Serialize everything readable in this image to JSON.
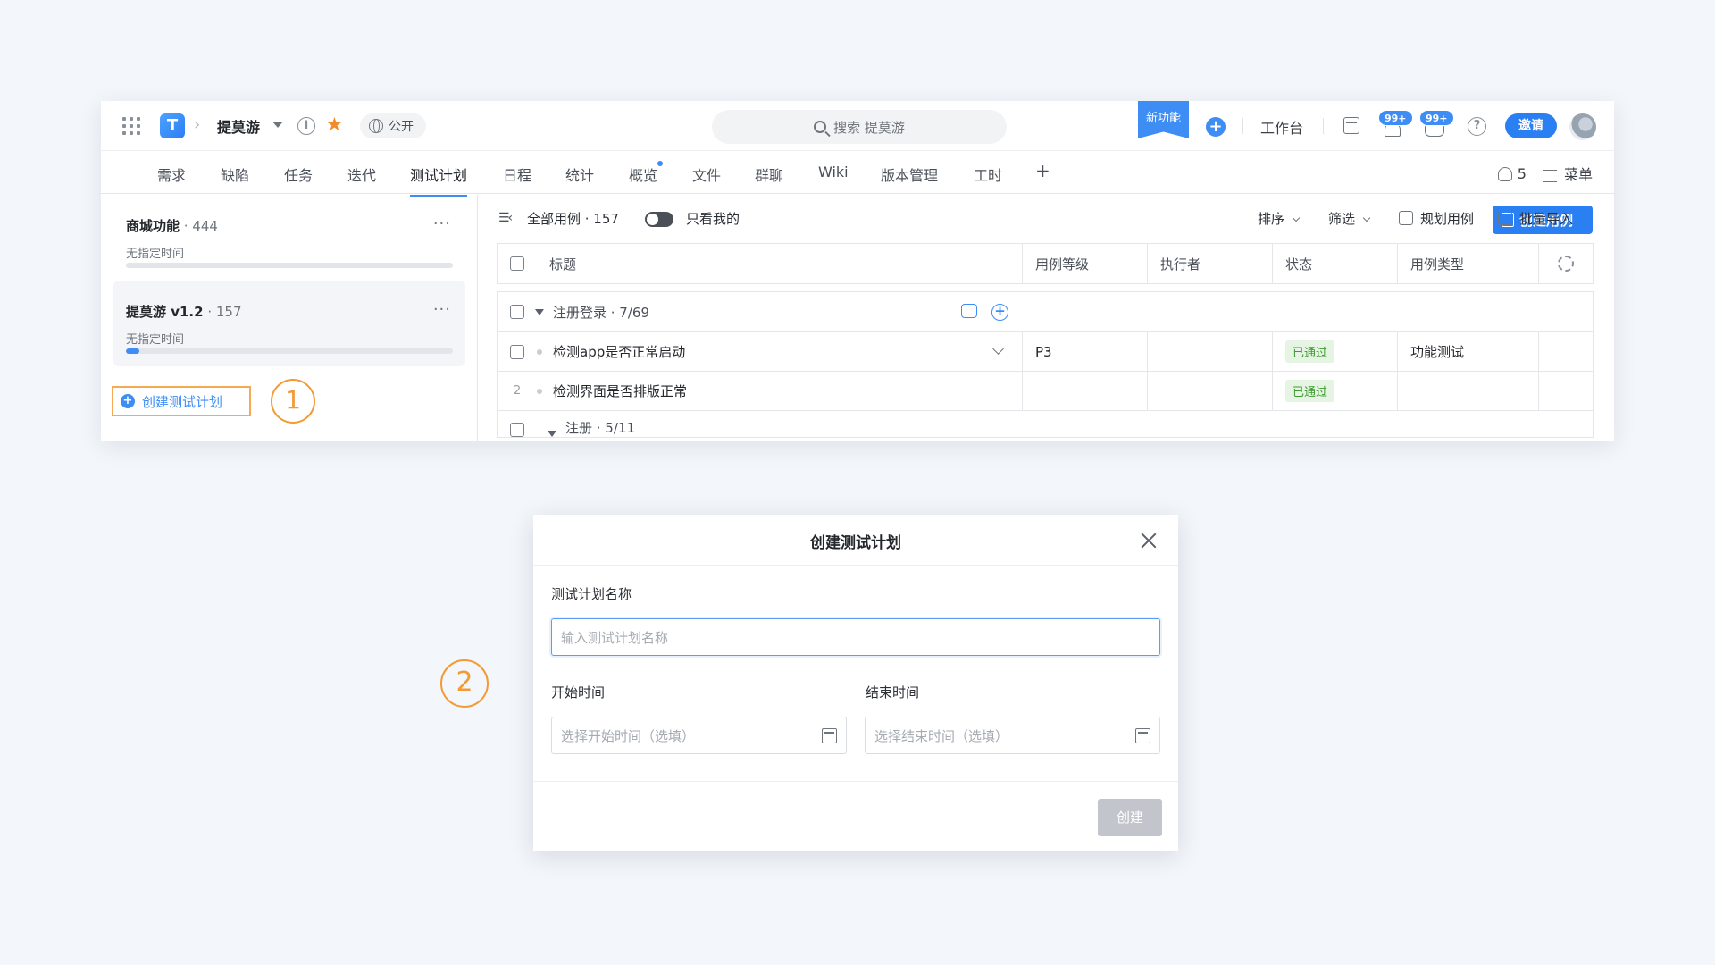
{
  "topbar": {
    "logo_glyph": "T",
    "project": "提莫游",
    "public_label": "公开",
    "search_label": "搜索 提莫游",
    "new_feature": "新功能",
    "workbench": "工作台",
    "notif_badge": "99+",
    "msg_badge": "99+",
    "invite": "邀请"
  },
  "tabs": [
    "需求",
    "缺陷",
    "任务",
    "迭代",
    "测试计划",
    "日程",
    "统计",
    "概览",
    "文件",
    "群聊",
    "Wiki",
    "版本管理",
    "工时"
  ],
  "active_tab": "测试计划",
  "tabs_right": {
    "members_count": "5",
    "menu": "菜单"
  },
  "sidebar": {
    "plans": [
      {
        "name": "商城功能",
        "count": " · 444",
        "subtitle": "无指定时间",
        "progress": 0
      },
      {
        "name": "提莫游 v1.2",
        "count": " · 157",
        "subtitle": "无指定时间",
        "progress": 0.04
      }
    ],
    "create_plan": "创建测试计划"
  },
  "steps": {
    "one": "1",
    "two": "2"
  },
  "toolbar": {
    "all_cases": "全部用例 · 157",
    "only_mine": "只看我的",
    "sort": "排序",
    "filter": "筛选",
    "plan_cases": "规划用例",
    "bulk_import": "批量导入",
    "create_case": "创建用例"
  },
  "table": {
    "headers": {
      "title": "标题",
      "level": "用例等级",
      "executor": "执行者",
      "status": "状态",
      "type": "用例类型"
    },
    "group1": "注册登录 · 7/69",
    "rows": [
      {
        "num": "",
        "title": "检测app是否正常启动",
        "level": "P3",
        "executor": "",
        "status": "已通过",
        "type": "功能测试"
      },
      {
        "num": "2",
        "title": "检测界面是否排版正常",
        "level": "",
        "executor": "",
        "status": "已通过",
        "type": ""
      }
    ],
    "group2": "注册 · 5/11"
  },
  "modal": {
    "title": "创建测试计划",
    "name_label": "测试计划名称",
    "name_placeholder": "输入测试计划名称",
    "start_label": "开始时间",
    "start_placeholder": "选择开始时间（选填）",
    "end_label": "结束时间",
    "end_placeholder": "选择结束时间（选填）",
    "create": "创建"
  },
  "colors": {
    "accent": "#2a7ff2",
    "annotation": "#f39a35",
    "passed_bg": "#e6f5e3",
    "passed_text": "#3c9a2f"
  }
}
